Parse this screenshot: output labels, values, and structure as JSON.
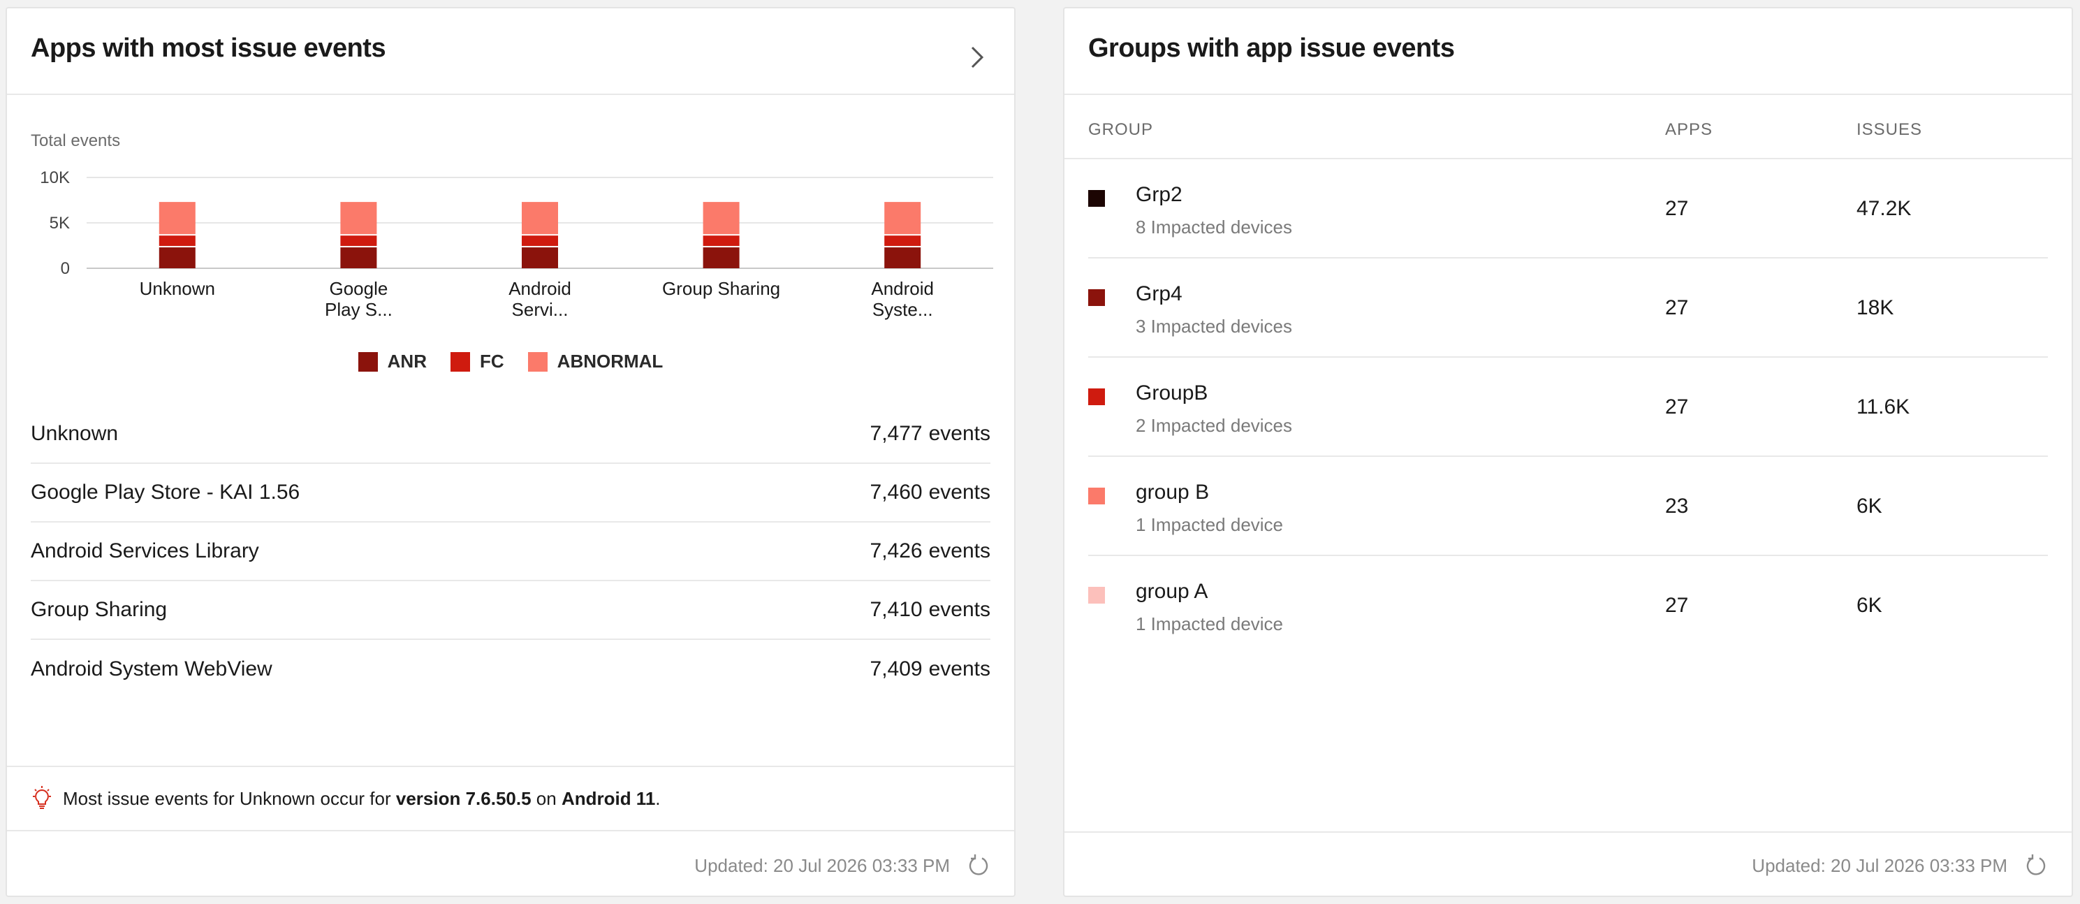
{
  "left_card": {
    "title": "Apps with most issue events",
    "y_axis_title": "Total events",
    "legend": [
      {
        "label": "ANR",
        "color": "#8b130c"
      },
      {
        "label": "FC",
        "color": "#cf1b0f"
      },
      {
        "label": "ABNORMAL",
        "color": "#fb7a6a"
      }
    ],
    "apps": [
      {
        "name": "Unknown",
        "count": "7,477",
        "unit": "events"
      },
      {
        "name": "Google Play Store - KAI 1.56",
        "count": "7,460",
        "unit": "events"
      },
      {
        "name": "Android Services Library",
        "count": "7,426",
        "unit": "events"
      },
      {
        "name": "Group Sharing",
        "count": "7,410",
        "unit": "events"
      },
      {
        "name": "Android System WebView",
        "count": "7,409",
        "unit": "events"
      }
    ],
    "insight": {
      "prefix": "Most issue events for Unknown occur for ",
      "version": "version 7.6.50.5",
      "middle": " on ",
      "os": "Android 11",
      "suffix": "."
    },
    "updated": "Updated: 20 Jul 2026 03:33 PM",
    "icons": {
      "chevron": "chevron-right-icon",
      "bulb": "lightbulb-icon",
      "refresh": "refresh-icon"
    }
  },
  "chart_data": {
    "type": "bar",
    "stacked": true,
    "categories": [
      [
        "Unknown"
      ],
      [
        "Google",
        "Play S..."
      ],
      [
        "Android",
        "Servi..."
      ],
      [
        "Group Sharing"
      ],
      [
        "Android",
        "Syste..."
      ]
    ],
    "series": [
      {
        "name": "ANR",
        "color": "#8b130c",
        "values": [
          2300,
          2300,
          2300,
          2300,
          2300
        ]
      },
      {
        "name": "FC",
        "color": "#cf1b0f",
        "values": [
          1300,
          1300,
          1300,
          1300,
          1300
        ]
      },
      {
        "name": "ABNORMAL",
        "color": "#fb7a6a",
        "values": [
          3700,
          3700,
          3700,
          3700,
          3700
        ]
      }
    ],
    "ylim": [
      0,
      10000
    ],
    "yticks": [
      0,
      5000,
      10000
    ],
    "ytick_labels": [
      "0",
      "5K",
      "10K"
    ],
    "ylabel": "Total events",
    "grid": true,
    "legend_position": "bottom"
  },
  "right_card": {
    "title": "Groups with app issue events",
    "columns": {
      "group": "GROUP",
      "apps": "APPS",
      "issues": "ISSUES"
    },
    "groups": [
      {
        "name": "Grp2",
        "sub": "8 Impacted devices",
        "apps": "27",
        "issues": "47.2K",
        "color": "#1c0503"
      },
      {
        "name": "Grp4",
        "sub": "3 Impacted devices",
        "apps": "27",
        "issues": "18K",
        "color": "#8b130c"
      },
      {
        "name": "GroupB",
        "sub": "2 Impacted devices",
        "apps": "27",
        "issues": "11.6K",
        "color": "#cf1b0f"
      },
      {
        "name": "group B",
        "sub": "1 Impacted device",
        "apps": "23",
        "issues": "6K",
        "color": "#fb7a6a"
      },
      {
        "name": "group A",
        "sub": "1 Impacted device",
        "apps": "27",
        "issues": "6K",
        "color": "#fcc0bb"
      }
    ],
    "updated": "Updated: 20 Jul 2026 03:33 PM"
  }
}
